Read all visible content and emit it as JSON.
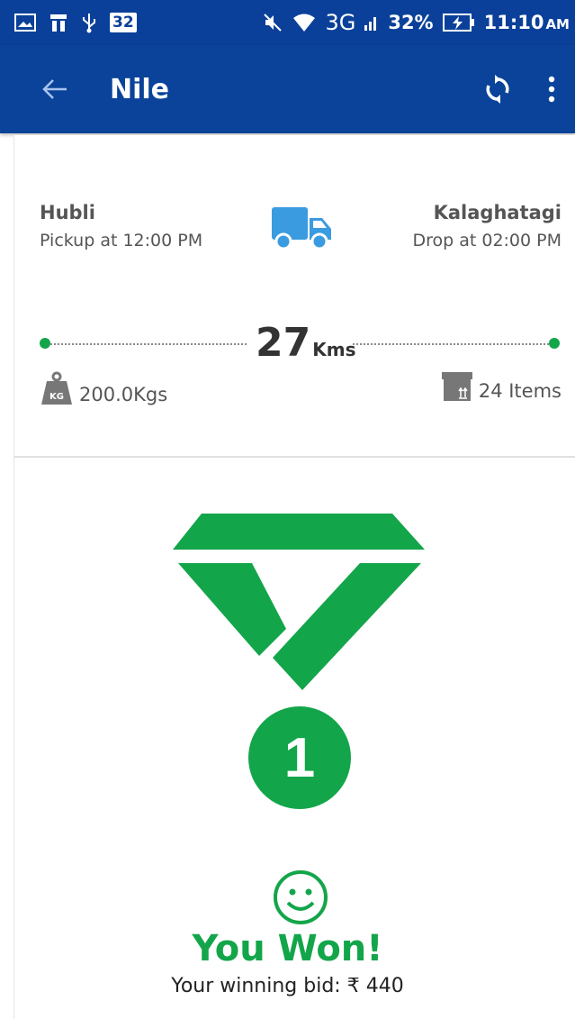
{
  "status_bar": {
    "sim_badge": "32",
    "network": "3G",
    "battery": "32%",
    "time": "11:10",
    "time_suffix": "AM"
  },
  "app_bar": {
    "title": "Nile"
  },
  "route": {
    "origin": {
      "city": "Hubli",
      "time_text": "Pickup at 12:00 PM"
    },
    "destination": {
      "city": "Kalaghatagi",
      "time_text": "Drop at 02:00 PM"
    },
    "distance_value": "27",
    "distance_unit": "Kms",
    "weight": "200.0Kgs",
    "weight_icon_label": "KG",
    "items": "24 Items"
  },
  "result": {
    "rank": "1",
    "headline": "You Won!",
    "bid_text": "Your winning bid: ₹ 440"
  },
  "colors": {
    "primary": "#0a4399",
    "accent_green": "#13a54a",
    "truck_blue": "#3a9be0"
  }
}
